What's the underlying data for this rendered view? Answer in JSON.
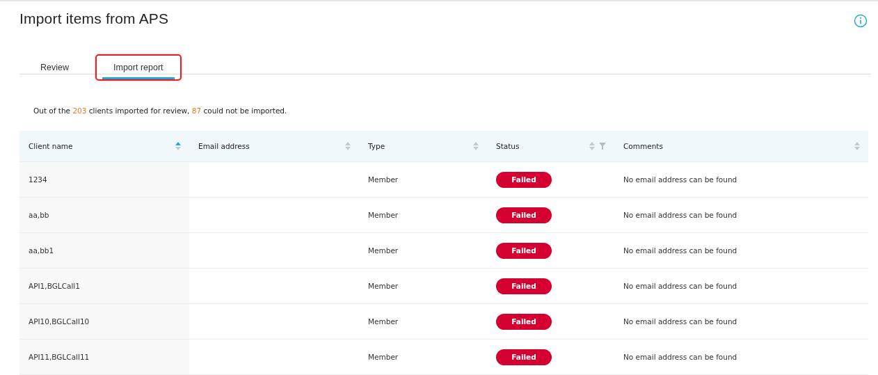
{
  "page": {
    "title": "Import items from APS"
  },
  "tabs": [
    {
      "label": "Review",
      "selected": false,
      "outlined": false
    },
    {
      "label": "Import report",
      "selected": true,
      "outlined": true
    }
  ],
  "summary": [
    {
      "text": "Out of the ",
      "highlight": false
    },
    {
      "text": "203",
      "highlight": true
    },
    {
      "text": " clients imported for review, ",
      "highlight": false
    },
    {
      "text": "87",
      "highlight": true
    },
    {
      "text": " could not be imported.",
      "highlight": false
    }
  ],
  "table": {
    "columns": [
      {
        "label": "Client name",
        "sorted": true,
        "filterable": false
      },
      {
        "label": "Email address",
        "sorted": false,
        "filterable": false
      },
      {
        "label": "Type",
        "sorted": false,
        "filterable": false
      },
      {
        "label": "Status",
        "sorted": false,
        "filterable": true
      },
      {
        "label": "Comments",
        "sorted": false,
        "filterable": false
      }
    ],
    "rows": [
      {
        "client": "1234",
        "type": "Member",
        "status": {
          "label": "Failed",
          "kind": "error"
        },
        "comment": "No email address can be found"
      },
      {
        "client": "aa,bb",
        "type": "Member",
        "status": {
          "label": "Failed",
          "kind": "error"
        },
        "comment": "No email address can be found"
      },
      {
        "client": "aa,bb1",
        "type": "Member",
        "status": {
          "label": "Failed",
          "kind": "error"
        },
        "comment": "No email address can be found"
      },
      {
        "client": "API1,BGLCall1",
        "type": "Member",
        "status": {
          "label": "Failed",
          "kind": "error"
        },
        "comment": "No email address can be found"
      },
      {
        "client": "API10,BGLCall10",
        "type": "Member",
        "status": {
          "label": "Failed",
          "kind": "error"
        },
        "comment": "No email address can be found"
      },
      {
        "client": "API11,BGLCall11",
        "type": "Member",
        "status": {
          "label": "Failed",
          "kind": "error"
        },
        "comment": "No email address can be found"
      }
    ]
  }
}
